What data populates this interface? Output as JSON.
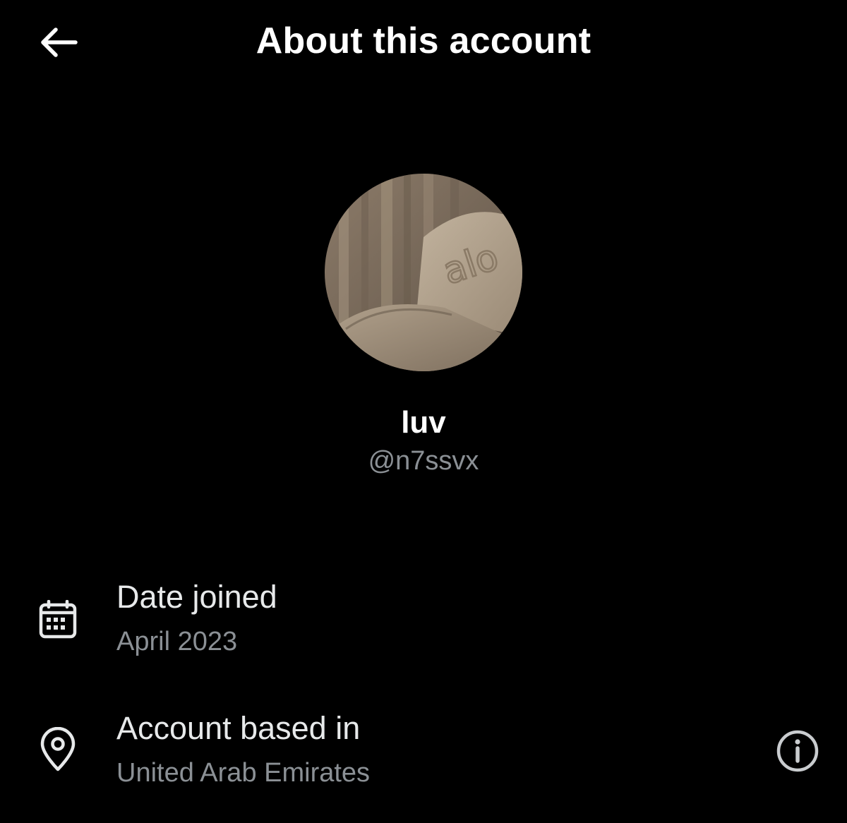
{
  "header": {
    "title": "About this account",
    "back_icon": "arrow-left-icon"
  },
  "profile": {
    "display_name": "luv",
    "handle": "@n7ssvx",
    "avatar_icon": "profile-photo",
    "avatar_logo_text": "alo"
  },
  "details": [
    {
      "icon": "calendar-icon",
      "title": "Date joined",
      "value": "April 2023"
    },
    {
      "icon": "location-pin-icon",
      "title": "Account based in",
      "value": "United Arab Emirates",
      "action_icon": "info-icon"
    }
  ],
  "colors": {
    "background": "#000000",
    "primary_text": "#e7e9ea",
    "secondary_text": "#8b9095"
  }
}
